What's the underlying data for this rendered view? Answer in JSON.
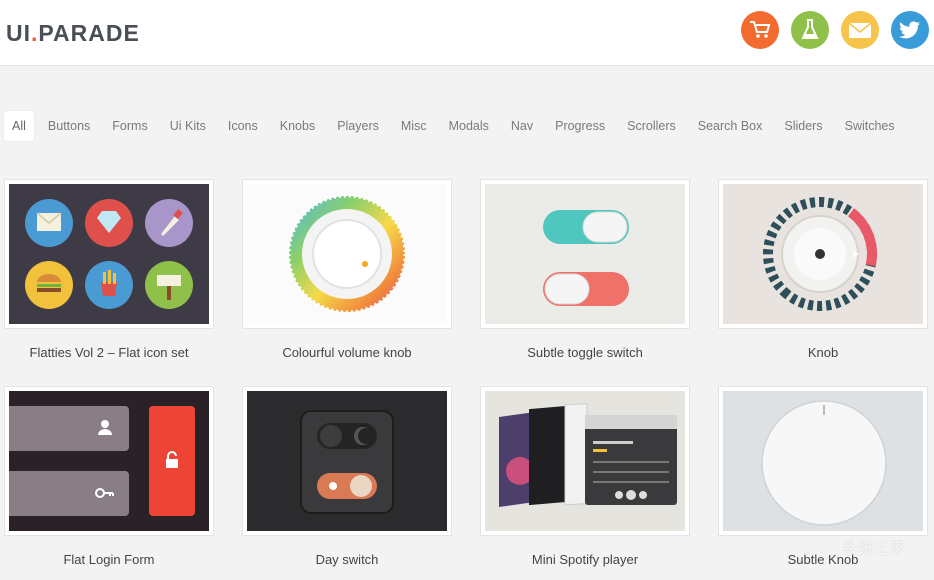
{
  "header": {
    "logo_main": "UI",
    "logo_dot": ".",
    "logo_rest": "PARADE"
  },
  "social": [
    {
      "icon": "cart-icon",
      "color": "#f26b2f"
    },
    {
      "icon": "flask-icon",
      "color": "#8fc04a"
    },
    {
      "icon": "mail-icon",
      "color": "#f6c44b"
    },
    {
      "icon": "twitter-icon",
      "color": "#3a9bd9"
    }
  ],
  "filters": [
    "All",
    "Buttons",
    "Forms",
    "Ui Kits",
    "Icons",
    "Knobs",
    "Players",
    "Misc",
    "Modals",
    "Nav",
    "Progress",
    "Scrollers",
    "Search Box",
    "Sliders",
    "Switches"
  ],
  "active_filter": "All",
  "cards": [
    {
      "title": "Flatties Vol 2 – Flat icon set"
    },
    {
      "title": "Colourful volume knob"
    },
    {
      "title": "Subtle toggle switch"
    },
    {
      "title": "Knob"
    },
    {
      "title": "Flat Login Form"
    },
    {
      "title": "Day switch"
    },
    {
      "title": "Mini Spotify player"
    },
    {
      "title": "Subtle Knob"
    }
  ],
  "watermark": "系统之家"
}
